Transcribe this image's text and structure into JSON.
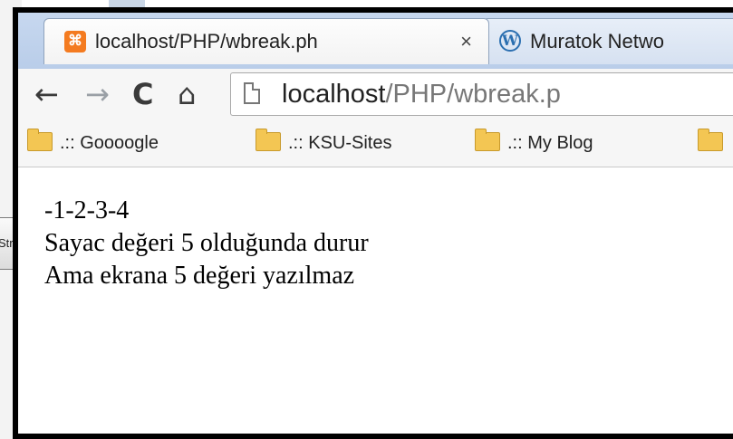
{
  "background": {
    "button_label": "Str"
  },
  "tabs": [
    {
      "title": "localhost/PHP/wbreak.ph",
      "close": "×",
      "icon": "xampp-favicon"
    },
    {
      "title": "Muratok Netwo",
      "icon": "wordpress-favicon"
    }
  ],
  "toolbar": {
    "back": "←",
    "forward": "→",
    "reload": "C",
    "home": "⌂",
    "url_host": "localhost",
    "url_path": "/PHP/wbreak.p"
  },
  "bookmarks": [
    {
      "label": ".:: Goooogle"
    },
    {
      "label": ".:: KSU-Sites"
    },
    {
      "label": ".:: My Blog"
    },
    {
      "label": ""
    }
  ],
  "page": {
    "lines": [
      "-1-2-3-4",
      "Sayac değeri 5 olduğunda durur",
      "Ama ekrana 5 değeri yazılmaz"
    ]
  }
}
